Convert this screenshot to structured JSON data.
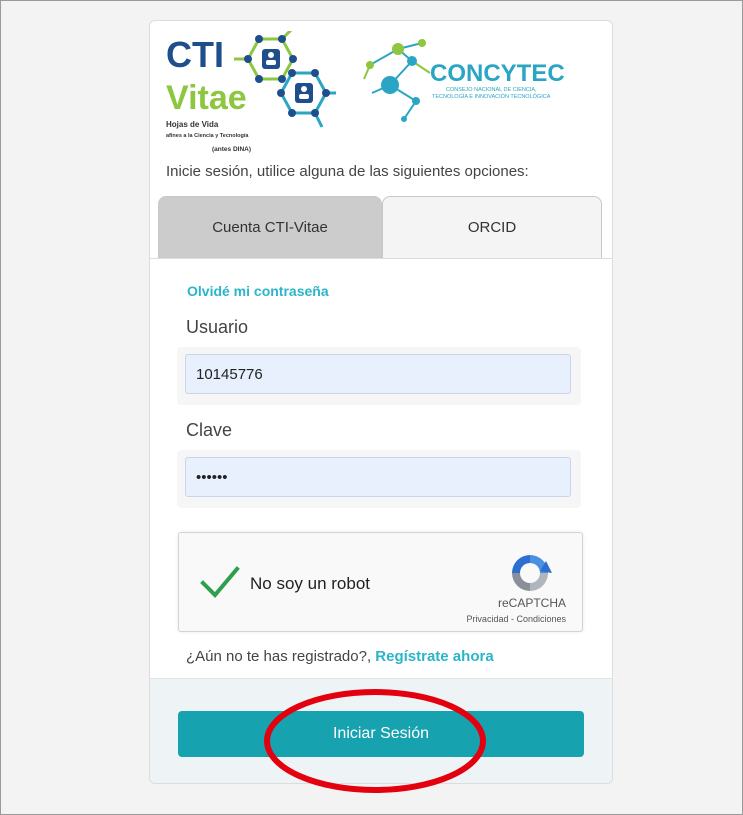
{
  "logos": {
    "cti_line1": "CTI",
    "cti_line2": "Vitae",
    "cti_tagline1": "Hojas de Vida",
    "cti_tagline2": "afines a la Ciencia y Tecnología",
    "cti_tagline3": "(antes DINA)",
    "concytec_name": "CONCYTEC",
    "concytec_sub1": "CONSEJO NACIONAL DE CIENCIA,",
    "concytec_sub2": "TECNOLOGÍA E INNOVACIÓN TECNOLÓGICA"
  },
  "intro_text": "Inicie sesión, utilice alguna de las siguientes opciones:",
  "tabs": [
    {
      "label": "Cuenta CTI-Vitae",
      "active": true
    },
    {
      "label": "ORCID",
      "active": false
    }
  ],
  "form": {
    "forgot_link": "Olvidé mi contraseña",
    "user_label": "Usuario",
    "user_value": "10145776",
    "password_label": "Clave",
    "password_value": "123456"
  },
  "captcha": {
    "label": "No soy un robot",
    "brand": "reCAPTCHA",
    "links": "Privacidad - Condiciones",
    "checked": true
  },
  "register": {
    "question": "¿Aún no te has registrado?, ",
    "link": "Regístrate ahora"
  },
  "submit_label": "Iniciar Sesión",
  "colors": {
    "accent": "#17a2b0",
    "link": "#2ab5c9",
    "annotation": "#e3000f",
    "check": "#2e9e4f"
  }
}
